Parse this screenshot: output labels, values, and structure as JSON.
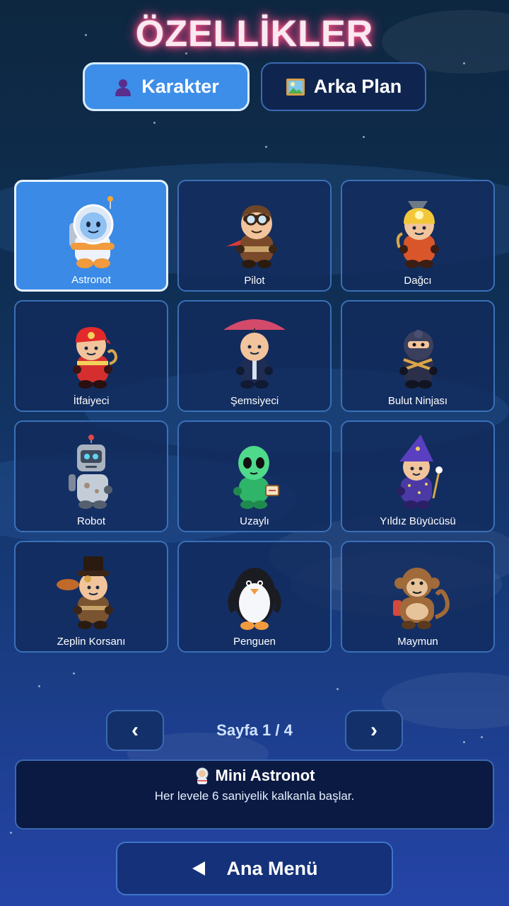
{
  "title": "ÖZELLİKLER",
  "tabs": [
    {
      "label": "Karakter",
      "icon": "person-icon",
      "active": true
    },
    {
      "label": "Arka Plan",
      "icon": "landscape-picture-icon",
      "active": false
    }
  ],
  "characters": [
    {
      "name": "Astronot",
      "icon": "astronaut-icon",
      "selected": true
    },
    {
      "name": "Pilot",
      "icon": "pilot-icon",
      "selected": false
    },
    {
      "name": "Dağcı",
      "icon": "climber-icon",
      "selected": false
    },
    {
      "name": "İtfaiyeci",
      "icon": "firefighter-icon",
      "selected": false
    },
    {
      "name": "Şemsiyeci",
      "icon": "umbrella-man-icon",
      "selected": false
    },
    {
      "name": "Bulut Ninjası",
      "icon": "ninja-icon",
      "selected": false
    },
    {
      "name": "Robot",
      "icon": "robot-icon",
      "selected": false
    },
    {
      "name": "Uzaylı",
      "icon": "alien-icon",
      "selected": false
    },
    {
      "name": "Yıldız Büyücüsü",
      "icon": "wizard-icon",
      "selected": false
    },
    {
      "name": "Zeplin Korsanı",
      "icon": "airship-pirate-icon",
      "selected": false
    },
    {
      "name": "Penguen",
      "icon": "penguin-icon",
      "selected": false
    },
    {
      "name": "Maymun",
      "icon": "monkey-icon",
      "selected": false
    }
  ],
  "pager": {
    "prev": "‹",
    "next": "›",
    "text": "Sayfa 1 / 4"
  },
  "info": {
    "icon": "astronaut-icon",
    "title": "Mini Astronot",
    "desc": "Her levele 6 saniyelik kalkanla başlar."
  },
  "menu_button": {
    "icon": "back-triangle-icon",
    "label": "Ana Menü"
  }
}
